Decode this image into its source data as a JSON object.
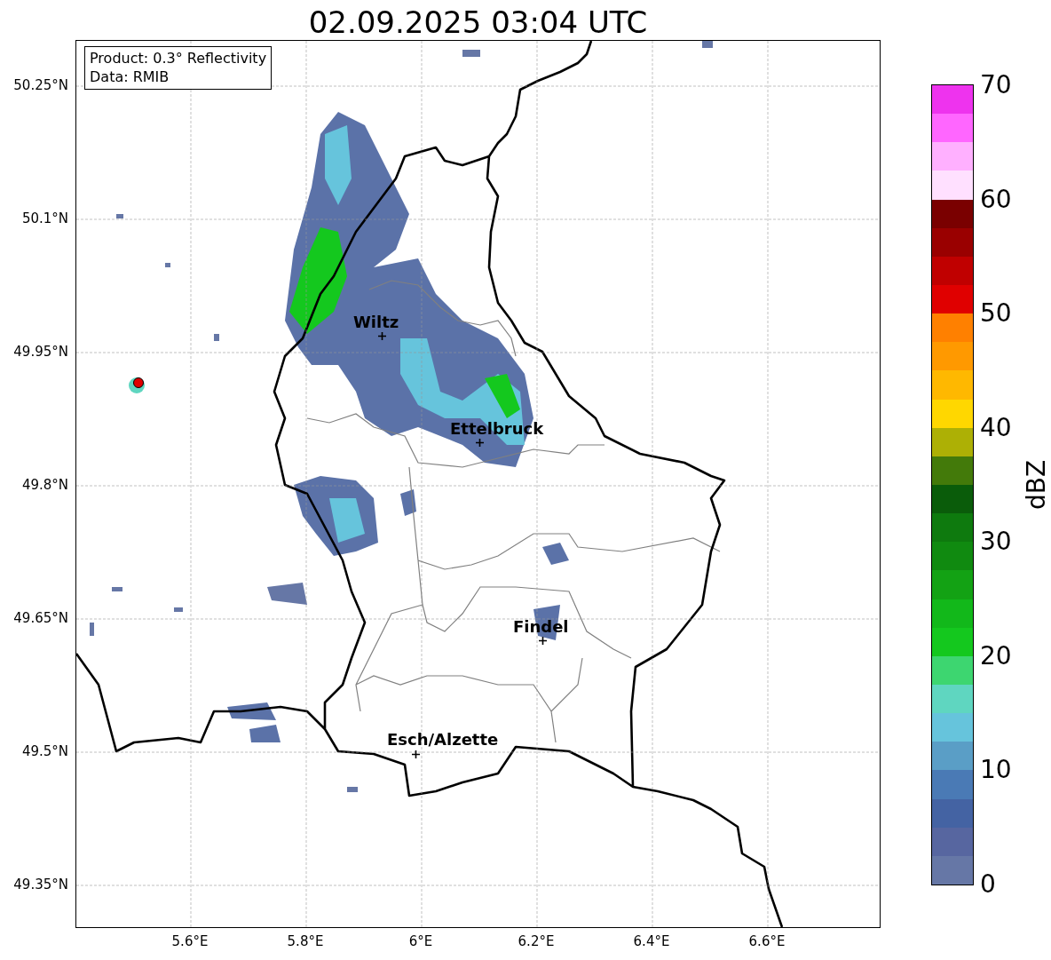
{
  "title": "02.09.2025 03:04 UTC",
  "info_box": {
    "lines": [
      "Product: 0.3° Reflectivity",
      "Data: RMIB"
    ]
  },
  "map": {
    "cities": [
      {
        "name": "Wiltz"
      },
      {
        "name": "Ettelbruck"
      },
      {
        "name": "Findel"
      },
      {
        "name": "Esch/Alzette"
      }
    ],
    "lat_ticks": [
      "50.25°N",
      "50.1°N",
      "49.95°N",
      "49.8°N",
      "49.65°N",
      "49.5°N",
      "49.35°N"
    ],
    "lon_ticks": [
      "5.6°E",
      "5.8°E",
      "6°E",
      "6.2°E",
      "6.4°E",
      "6.6°E"
    ]
  },
  "colorbar": {
    "label": "dBZ",
    "ticks": [
      "70",
      "60",
      "50",
      "40",
      "30",
      "20",
      "10",
      "0"
    ],
    "segments": [
      {
        "color": "#6677a6"
      },
      {
        "color": "#5766a0"
      },
      {
        "color": "#4463a3"
      },
      {
        "color": "#4a7ab5"
      },
      {
        "color": "#5a9ec6"
      },
      {
        "color": "#66c4dc"
      },
      {
        "color": "#5fd6c0"
      },
      {
        "color": "#3dd670"
      },
      {
        "color": "#14c81e"
      },
      {
        "color": "#12b81a"
      },
      {
        "color": "#13a214"
      },
      {
        "color": "#108a10"
      },
      {
        "color": "#0e7a0e"
      },
      {
        "color": "#0a5c0a"
      },
      {
        "color": "#437a0a"
      },
      {
        "color": "#adb005"
      },
      {
        "color": "#ffd700"
      },
      {
        "color": "#ffb800"
      },
      {
        "color": "#ff9900"
      },
      {
        "color": "#ff8000"
      },
      {
        "color": "#e00000"
      },
      {
        "color": "#c00000"
      },
      {
        "color": "#9a0000"
      },
      {
        "color": "#7a0000"
      },
      {
        "color": "#ffe0ff"
      },
      {
        "color": "#ffb0ff"
      },
      {
        "color": "#ff66ff"
      },
      {
        "color": "#ee33ee"
      }
    ]
  }
}
